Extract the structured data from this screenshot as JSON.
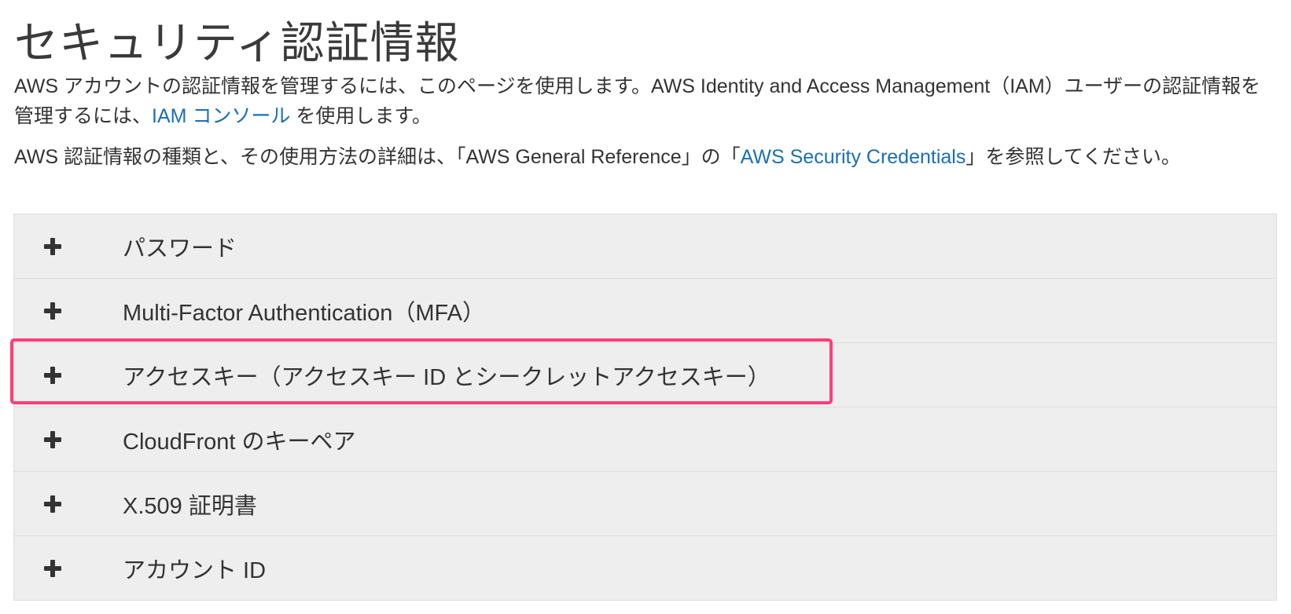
{
  "page": {
    "title": "セキュリティ認証情報",
    "intro": {
      "text_before": "AWS アカウントの認証情報を管理するには、このページを使用します。AWS Identity and Access Management（IAM）ユーザーの認証情報を管理するには、",
      "link": "IAM コンソール",
      "text_after": " を使用します。"
    },
    "reference": {
      "text_before": "AWS 認証情報の種類と、その使用方法の詳細は、「AWS General Reference」の「",
      "link": "AWS Security Credentials",
      "text_after": "」を参照してください。"
    }
  },
  "sections": [
    {
      "label": "パスワード",
      "icon": "plus-icon"
    },
    {
      "label": "Multi-Factor Authentication（MFA）",
      "icon": "plus-icon"
    },
    {
      "label": "アクセスキー（アクセスキー ID とシークレットアクセスキー）",
      "icon": "plus-icon"
    },
    {
      "label": "CloudFront のキーペア",
      "icon": "plus-icon"
    },
    {
      "label": "X.509 証明書",
      "icon": "plus-icon"
    },
    {
      "label": "アカウント ID",
      "icon": "plus-icon"
    }
  ],
  "colors": {
    "link": "#1a6fb5",
    "highlight": "#ff3d7a",
    "panel_bg": "#eeeeee"
  }
}
